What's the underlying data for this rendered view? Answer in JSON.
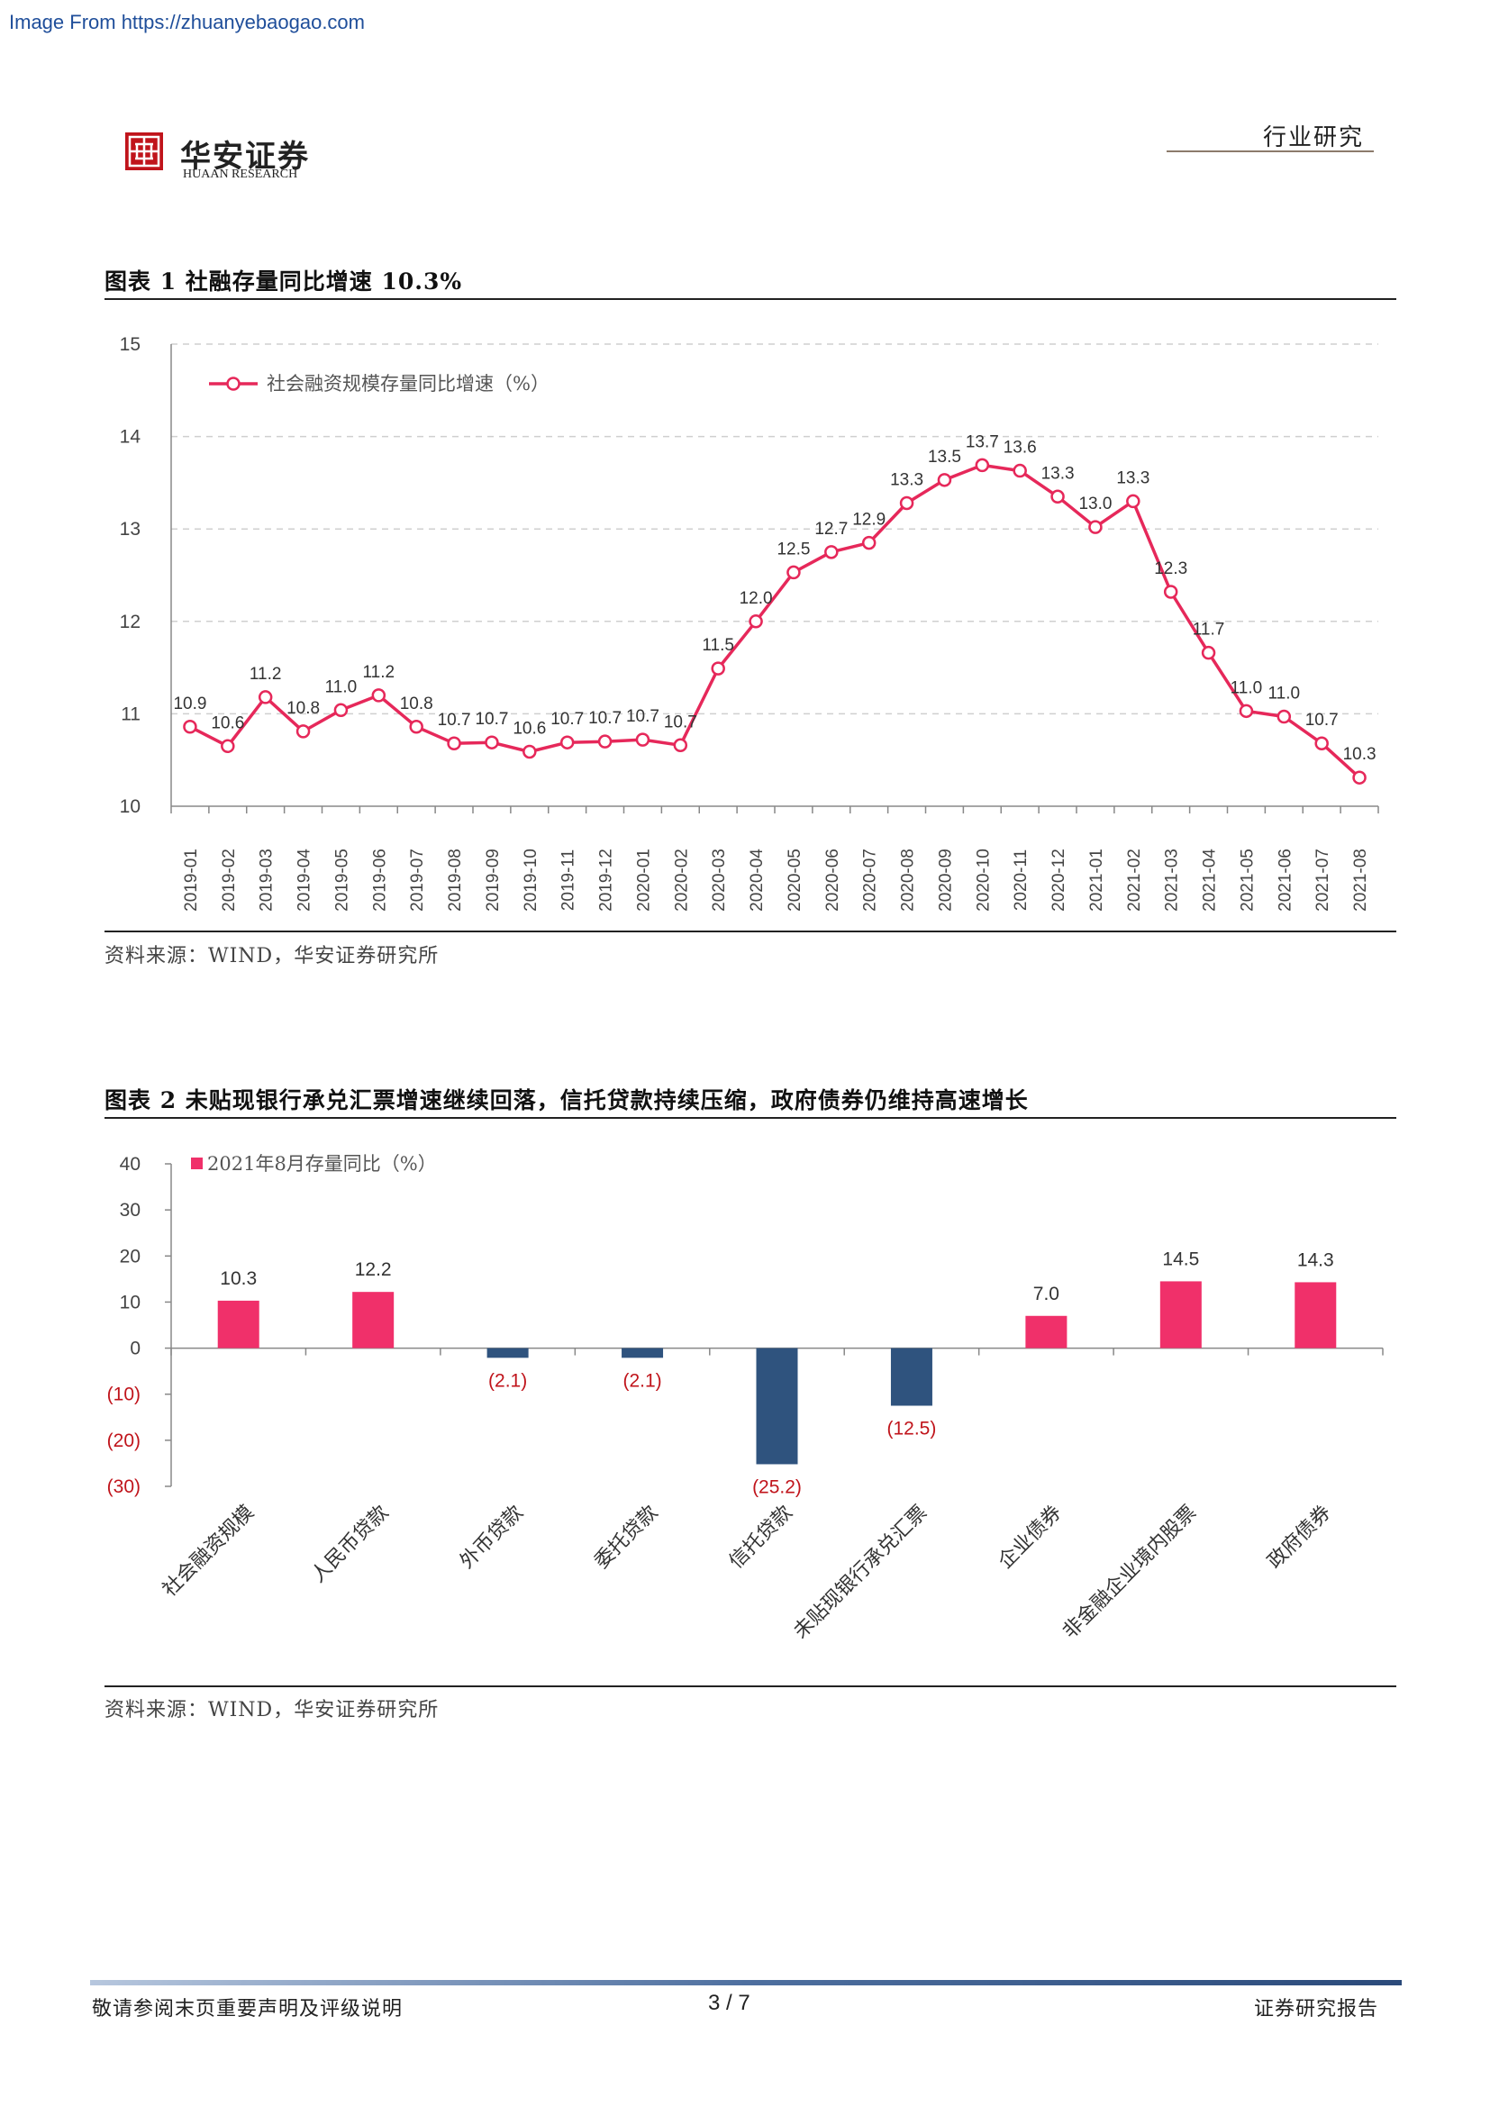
{
  "watermark": "Image From https://zhuanyebaogao.com",
  "header": {
    "logo_cn": "华安证券",
    "logo_en": "HUAAN RESEARCH",
    "section": "行业研究"
  },
  "figure1": {
    "title": "图表 1 社融存量同比增速 10.3%",
    "source": "资料来源：WIND，华安证券研究所",
    "chart_data": {
      "type": "line",
      "title": "",
      "xlabel": "",
      "ylabel": "",
      "ylim": [
        10,
        15
      ],
      "yticks": [
        "15",
        "14",
        "13",
        "12",
        "11",
        "10"
      ],
      "grid": true,
      "legend_position": "top-left",
      "series_color": "#e6285a",
      "x": [
        "2019-01",
        "2019-02",
        "2019-03",
        "2019-04",
        "2019-05",
        "2019-06",
        "2019-07",
        "2019-08",
        "2019-09",
        "2019-10",
        "2019-11",
        "2019-12",
        "2020-01",
        "2020-02",
        "2020-03",
        "2020-04",
        "2020-05",
        "2020-06",
        "2020-07",
        "2020-08",
        "2020-09",
        "2020-10",
        "2020-11",
        "2020-12",
        "2021-01",
        "2021-02",
        "2021-03",
        "2021-04",
        "2021-05",
        "2021-06",
        "2021-07",
        "2021-08"
      ],
      "series": [
        {
          "name": "社会融资规模存量同比增速（%）",
          "values": [
            10.86,
            10.65,
            11.18,
            10.81,
            11.04,
            11.2,
            10.86,
            10.68,
            10.69,
            10.59,
            10.69,
            10.7,
            10.72,
            10.66,
            11.49,
            12.0,
            12.53,
            12.75,
            12.85,
            13.28,
            13.53,
            13.69,
            13.63,
            13.35,
            13.02,
            13.3,
            12.32,
            11.66,
            11.03,
            10.97,
            10.68,
            10.31
          ],
          "labels": [
            "10.9",
            "10.6",
            "11.2",
            "10.8",
            "11.0",
            "11.2",
            "10.8",
            "10.7",
            "10.7",
            "10.6",
            "10.7",
            "10.7",
            "10.7",
            "10.7",
            "11.5",
            "12.0",
            "12.5",
            "12.7",
            "12.9",
            "13.3",
            "13.5",
            "13.7",
            "13.6",
            "13.3",
            "13.0",
            "13.3",
            "12.3",
            "11.7",
            "11.0",
            "11.0",
            "10.7",
            "10.3"
          ]
        }
      ]
    }
  },
  "figure2": {
    "title": "图表 2 未贴现银行承兑汇票增速继续回落，信托贷款持续压缩，政府债券仍维持高速增长",
    "source": "资料来源：WIND，华安证券研究所",
    "chart_data": {
      "type": "bar",
      "title": "",
      "xlabel": "",
      "ylabel": "",
      "ylim": [
        -30,
        40
      ],
      "yticks": [
        "40",
        "30",
        "20",
        "10",
        "0",
        "(10)",
        "(20)",
        "(30)"
      ],
      "grid": false,
      "legend_position": "top-left",
      "positive_color": "#f0306a",
      "negative_color": "#2f537e",
      "categories": [
        "社会融资规模",
        "人民币贷款",
        "外币贷款",
        "委托贷款",
        "信托贷款",
        "未贴现银行承兑汇票",
        "企业债券",
        "非金融企业境内股票",
        "政府债券"
      ],
      "series": [
        {
          "name": "2021年8月存量同比（%）",
          "values": [
            10.3,
            12.2,
            -2.1,
            -2.1,
            -25.2,
            -12.5,
            7.0,
            14.5,
            14.3
          ],
          "labels": [
            "10.3",
            "12.2",
            "(2.1)",
            "(2.1)",
            "(25.2)",
            "(12.5)",
            "7.0",
            "14.5",
            "14.3"
          ]
        }
      ]
    }
  },
  "footer": {
    "left": "敬请参阅末页重要声明及评级说明",
    "page": "3 / 7",
    "right": "证券研究报告"
  }
}
